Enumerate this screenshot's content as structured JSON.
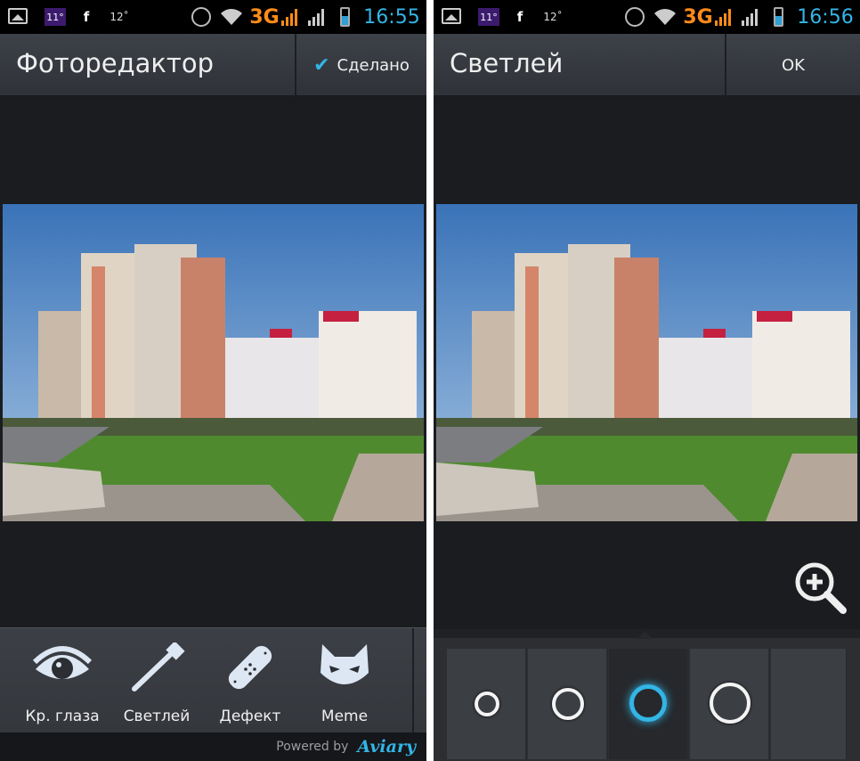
{
  "status_bar_left": {
    "temp": "11°",
    "fb": "f",
    "num": "12˚",
    "network": "3G",
    "time": "16:55"
  },
  "status_bar_right": {
    "temp": "11°",
    "fb": "f",
    "num": "12˚",
    "network": "3G",
    "time": "16:56"
  },
  "editor": {
    "title": "Фоторедактор",
    "done_label": "Сделано",
    "tools": [
      {
        "label": "Кр. глаза",
        "icon": "eye-icon"
      },
      {
        "label": "Светлей",
        "icon": "brush-icon"
      },
      {
        "label": "Дефект",
        "icon": "bandage-icon"
      },
      {
        "label": "Meme",
        "icon": "cat-icon"
      }
    ],
    "powered_by": "Powered by",
    "brand": "Aviary"
  },
  "lighten": {
    "title": "Светлей",
    "ok_label": "OK",
    "brush_sizes": [
      "small",
      "medium",
      "large",
      "xlarge"
    ],
    "selected_brush": 2
  },
  "colors": {
    "accent": "#33b5e5",
    "status_orange": "#ff8b1a",
    "background": "#1b1c20"
  },
  "icons": [
    "gallery-icon",
    "facebook-icon",
    "alarm-icon",
    "wifi-icon",
    "signal-icon",
    "battery-icon",
    "zoom-in-icon",
    "check-icon"
  ]
}
